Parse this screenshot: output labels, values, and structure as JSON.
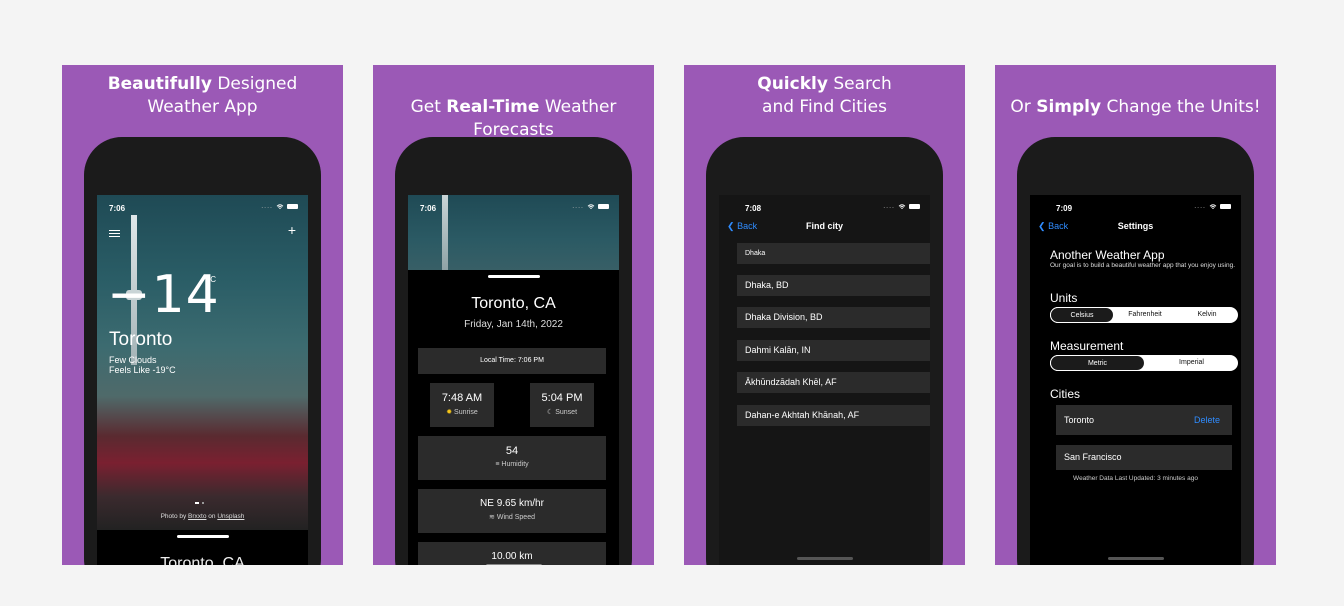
{
  "panels": [
    {
      "title_bold": "Beautifully",
      "title_rest": " Designed",
      "title_line2": "Weather App"
    },
    {
      "title_pre": "Get ",
      "title_bold": "Real-Time",
      "title_rest": " Weather Forecasts"
    },
    {
      "title_bold": "Quickly",
      "title_rest": " Search",
      "title_line2": "and Find Cities"
    },
    {
      "title_pre": "Or ",
      "title_bold": "Simply",
      "title_rest": " Change the Units!"
    }
  ],
  "screen1": {
    "time": "7:06",
    "temp": "−14",
    "unit": "°C",
    "city": "Toronto",
    "condition": "Few Clouds",
    "feels_like": "Feels Like -19°C",
    "credit_prefix": "Photo by ",
    "credit_author": "Brxxto",
    "credit_mid": " on ",
    "credit_site": "Unsplash",
    "bottom_city": "Toronto, CA"
  },
  "screen2": {
    "time": "7:06",
    "city": "Toronto, CA",
    "date": "Friday, Jan 14th, 2022",
    "local_time": "Local Time:  7:06 PM",
    "sunrise_time": "7:48 AM",
    "sunrise_label": "Sunrise",
    "sunset_time": "5:04 PM",
    "sunset_label": "Sunset",
    "humidity_value": "54",
    "humidity_label": "Humidity",
    "wind_value": "NE  9.65 km/hr",
    "wind_label": "Wind Speed",
    "visibility_value": "10.00 km"
  },
  "screen3": {
    "time": "7:08",
    "back_label": "Back",
    "title": "Find city",
    "search_value": "Dhaka",
    "results": [
      "Dhaka, BD",
      "Dhaka Division, BD",
      "Dahmi Kalān, IN",
      "Ākhūndzādah Khēl, AF",
      "Dahan-e Akhtah Khānah, AF"
    ]
  },
  "screen4": {
    "time": "7:09",
    "back_label": "Back",
    "title": "Settings",
    "app_name": "Another Weather App",
    "app_desc": "Our goal is to build a beautiful weather app that you enjoy using.",
    "units_label": "Units",
    "units": [
      "Celsius",
      "Fahrenheit",
      "Kelvin"
    ],
    "measurement_label": "Measurement",
    "measurements": [
      "Metric",
      "Imperial"
    ],
    "cities_label": "Cities",
    "cities": [
      "Toronto",
      "San Francisco"
    ],
    "delete_label": "Delete",
    "updated": "Weather Data Last Updated: 3 minutes ago"
  }
}
